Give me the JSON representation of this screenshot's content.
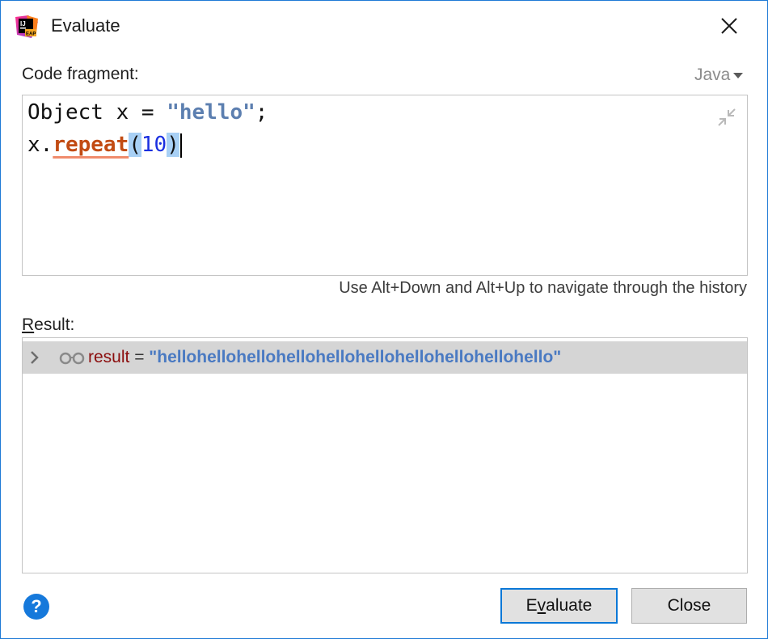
{
  "window": {
    "title": "Evaluate",
    "app_icon": "intellij-eap-icon",
    "close_icon": "close-icon"
  },
  "code_fragment": {
    "label": "Code fragment:",
    "language": "Java",
    "line1": {
      "a": "Object x = ",
      "b": "\"hello\"",
      "c": ";"
    },
    "line2": {
      "a": "x.",
      "method": "repeat",
      "open": "(",
      "num": "10",
      "close": ")"
    },
    "history_hint": "Use Alt+Down and Alt+Up to navigate through the history"
  },
  "result": {
    "label_mnemonic": "R",
    "label_rest": "esult:",
    "name": "result",
    "eq": " = ",
    "value": "\"hellohellohellohellohellohellohellohellohellohello\""
  },
  "buttons": {
    "evaluate_pre": "E",
    "evaluate_mnemonic": "v",
    "evaluate_post": "aluate",
    "close": "Close",
    "help": "?"
  },
  "colors": {
    "accent": "#0b78d7",
    "string": "#5c7fb0",
    "method": "#c24b13",
    "number": "#1a2fe0",
    "result_name": "#8b0d0d",
    "result_value": "#4a7ac2"
  }
}
